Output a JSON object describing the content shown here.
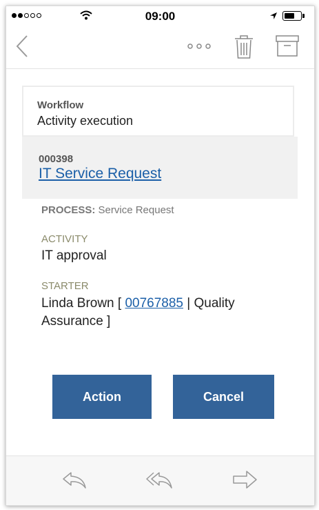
{
  "status_bar": {
    "time": "09:00",
    "signal_filled": 2,
    "signal_total": 5,
    "icons": [
      "wifi-icon",
      "location-arrow-icon",
      "battery-icon"
    ]
  },
  "nav": {
    "icons": [
      "chevron-left-icon",
      "more-dots-icon",
      "trash-icon",
      "archive-icon"
    ]
  },
  "workflow": {
    "label": "Workflow",
    "title": "Activity execution"
  },
  "request": {
    "number": "000398",
    "title": "IT Service Request"
  },
  "process": {
    "label": "PROCESS:",
    "value": "Service Request"
  },
  "activity": {
    "label": "ACTIVITY",
    "value": "IT approval"
  },
  "starter": {
    "label": "STARTER",
    "name": "Linda Brown [",
    "id_link": "00767885",
    "department": "| Quality Assurance ]"
  },
  "buttons": {
    "action": "Action",
    "cancel": "Cancel"
  },
  "toolbar": {
    "icons": [
      "reply-icon",
      "reply-all-icon",
      "forward-icon"
    ]
  },
  "colors": {
    "button": "#336399",
    "link": "#1b5fa8",
    "label_olive": "#8a8a6a"
  }
}
